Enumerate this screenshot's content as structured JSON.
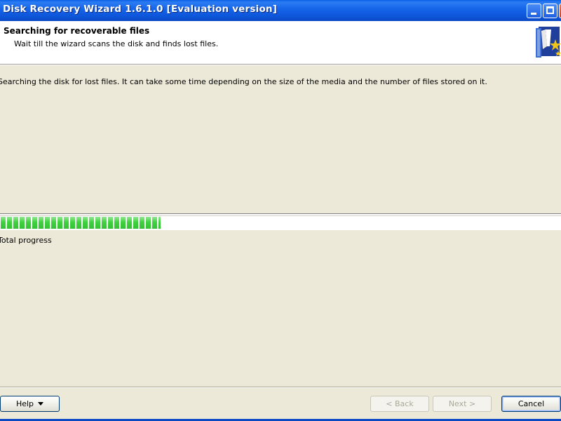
{
  "window": {
    "title": "Disk Recovery Wizard 1.6.1.0 [Evaluation version]",
    "controls": [
      "minimize-icon",
      "maximize-icon",
      "close-icon"
    ]
  },
  "header": {
    "title": "Searching for recoverable files",
    "subtitle": "Wait till the wizard scans the disk and finds lost files.",
    "art_icon": "wizard-book-icon"
  },
  "main": {
    "description": "Searching the disk for lost files. It can take some time depending on the size of the media and the number of files stored on it.",
    "progress": {
      "label": "Total progress",
      "fraction": 0.285,
      "color": "#3fd23f"
    }
  },
  "footer": {
    "help_label": "Help",
    "back_label": "< Back",
    "next_label": "Next >",
    "cancel_label": "Cancel"
  },
  "colors": {
    "titlebar": "#0d54d8",
    "dialog_bg": "#ece9d8",
    "header_bg": "#ffffff"
  }
}
